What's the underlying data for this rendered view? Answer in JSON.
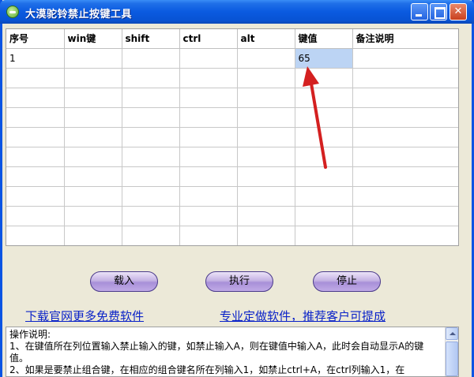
{
  "window": {
    "title": "大漠驼铃禁止按键工具"
  },
  "grid": {
    "columns": [
      "序号",
      "win键",
      "shift",
      "ctrl",
      "alt",
      "键值",
      "备注说明"
    ],
    "rows": [
      [
        "1",
        "",
        "",
        "",
        "",
        "65",
        ""
      ],
      [
        "",
        "",
        "",
        "",
        "",
        "",
        ""
      ],
      [
        "",
        "",
        "",
        "",
        "",
        "",
        ""
      ],
      [
        "",
        "",
        "",
        "",
        "",
        "",
        ""
      ],
      [
        "",
        "",
        "",
        "",
        "",
        "",
        ""
      ],
      [
        "",
        "",
        "",
        "",
        "",
        "",
        ""
      ],
      [
        "",
        "",
        "",
        "",
        "",
        "",
        ""
      ],
      [
        "",
        "",
        "",
        "",
        "",
        "",
        ""
      ],
      [
        "",
        "",
        "",
        "",
        "",
        "",
        ""
      ],
      [
        "",
        "",
        "",
        "",
        "",
        "",
        ""
      ]
    ],
    "selected_cell": {
      "row": 0,
      "col": 5
    }
  },
  "buttons": {
    "load": "载入",
    "execute": "执行",
    "stop": "停止"
  },
  "links": {
    "download": "下载官网更多免费软件",
    "custom": "专业定做软件，推荐客户可提成"
  },
  "instructions": {
    "lines": [
      "操作说明:",
      "1、在键值所在列位置输入禁止输入的键，如禁止输入A，则在键值中输入A，此时会自动显示A的键值。",
      "2、如果是要禁止组合键，在相应的组合键名所在列输入1，如禁止ctrl+A，在ctrl列输入1，在"
    ]
  },
  "colors": {
    "titlebar": "#0a5ae0",
    "selected_cell": "#bcd4f4",
    "link": "#0a22c8",
    "arrow": "#d42020"
  }
}
